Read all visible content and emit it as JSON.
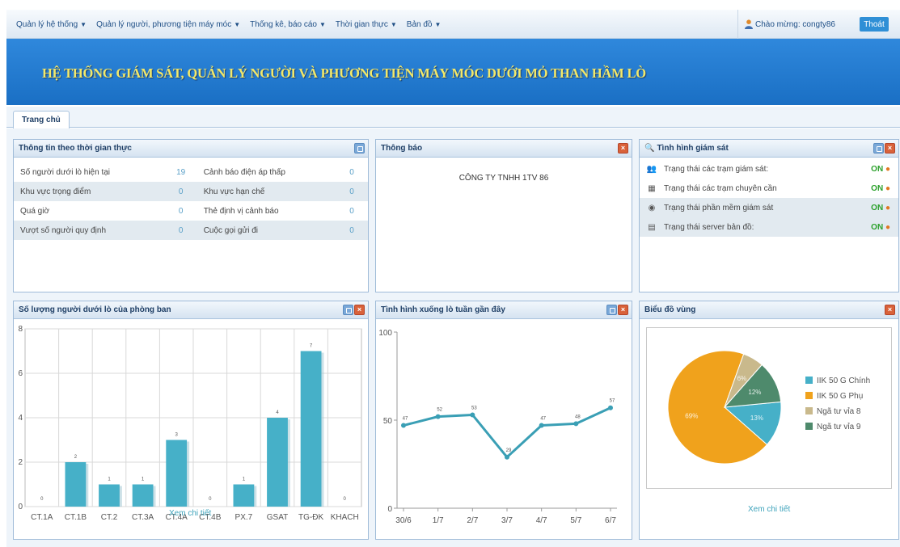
{
  "nav": {
    "menu": [
      "Quản lý hệ thống",
      "Quản lý người, phương tiện máy móc",
      "Thống kê, báo cáo",
      "Thời gian thực",
      "Bản đồ"
    ],
    "greeting": "Chào mừng: congty86",
    "logout": "Thoát"
  },
  "banner": {
    "title": "HỆ THỐNG GIÁM SÁT, QUẢN LÝ NGƯỜI VÀ PHƯƠNG TIỆN MÁY MÓC DƯỚI MỎ THAN HẦM LÒ"
  },
  "tabs": [
    "Trang chủ"
  ],
  "realtime": {
    "title": "Thông tin theo thời gian thực",
    "rows": [
      {
        "left_label": "Số người dưới lò hiện tại",
        "left_value": "19",
        "right_label": "Cảnh báo điện áp thấp",
        "right_value": "0"
      },
      {
        "left_label": "Khu vực trọng điểm",
        "left_value": "0",
        "right_label": "Khu vực hạn chế",
        "right_value": "0"
      },
      {
        "left_label": "Quá giờ",
        "left_value": "0",
        "right_label": "Thẻ định vị cảnh báo",
        "right_value": "0"
      },
      {
        "left_label": "Vượt số người quy định",
        "left_value": "0",
        "right_label": "Cuộc gọi gửi đi",
        "right_value": "0"
      }
    ]
  },
  "notice": {
    "title": "Thông báo",
    "text": "CÔNG TY TNHH 1TV 86"
  },
  "monitor": {
    "title": "Tình hình giám sát",
    "rows": [
      {
        "icon": "people-icon",
        "glyph": "👥",
        "label": "Trạng thái các trạm giám sát:",
        "status": "ON"
      },
      {
        "icon": "station-icon",
        "glyph": "▦",
        "label": "Trạng thái các trạm chuyên cần",
        "status": "ON"
      },
      {
        "icon": "eye-icon",
        "glyph": "◉",
        "label": "Trạng thái phần mềm giám sát",
        "status": "ON"
      },
      {
        "icon": "server-icon",
        "glyph": "▤",
        "label": "Trạng thái server bản đồ:",
        "status": "ON"
      }
    ],
    "on_color": "#2aa02a",
    "dot_color": "#e07820"
  },
  "colors": {
    "banner": "#1f7bd0",
    "banner_text": "#f2e86a",
    "accent": "#46b0c8",
    "bar": "#46b0c8",
    "line": "#3a9fb5"
  },
  "chart_data": [
    {
      "panel_title": "Số lượng người dưới lò của phòng ban",
      "type": "bar",
      "categories": [
        "CT.1A",
        "CT.1B",
        "CT.2",
        "CT.3A",
        "CT.4A",
        "CT.4B",
        "PX.7",
        "GSAT",
        "TG-ĐK",
        "KHACH"
      ],
      "values": [
        0,
        2,
        1,
        1,
        3,
        0,
        1,
        4,
        7,
        0
      ],
      "ylim": [
        0,
        8
      ],
      "yticks": [
        0,
        2,
        4,
        6,
        8
      ],
      "grid": true,
      "link": "Xem chi tiết"
    },
    {
      "panel_title": "Tình hình xuống lò tuần gần đây",
      "type": "line",
      "categories": [
        "30/6",
        "1/7",
        "2/7",
        "3/7",
        "4/7",
        "5/7",
        "6/7"
      ],
      "values": [
        47,
        52,
        53,
        29,
        47,
        48,
        57
      ],
      "ylim": [
        0,
        100
      ],
      "yticks": [
        0,
        50,
        100
      ]
    },
    {
      "panel_title": "Biểu đồ vùng",
      "type": "pie",
      "slices": [
        {
          "label": "IIK 50 G Chính",
          "value": 13,
          "color": "#46b0c8"
        },
        {
          "label": "IIK 50 G Phụ",
          "value": 69,
          "color": "#f0a21c"
        },
        {
          "label": "Ngã tư vỉa 8",
          "value": 6,
          "color": "#c9b98c"
        },
        {
          "label": "Ngã tư vỉa 9",
          "value": 12,
          "color": "#4e8a6c"
        }
      ],
      "legend_position": "right",
      "link": "Xem chi tiết"
    }
  ]
}
